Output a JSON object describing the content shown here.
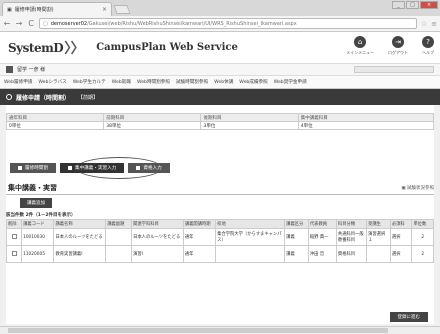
{
  "browser": {
    "tab_title": "履修申請(時間割)",
    "tab_close": "×",
    "back": "←",
    "forward": "→",
    "reload": "C",
    "url_domain": "demoserver02",
    "url_path": "/Gakusei/web/Rishu/WebRishuShinsei/kamwari/UI/WRS_RishuShinsei_Ikamwari.aspx",
    "win_min": "_",
    "win_max": "□",
    "win_close": "×"
  },
  "header": {
    "logo_text": "SystemD",
    "logo_chevrons": "〉〉",
    "service_name": "CampusPlan Web Service",
    "icons": [
      {
        "label": "メインメニュー",
        "glyph": "⌂"
      },
      {
        "label": "ログアウト",
        "glyph": "⇥"
      },
      {
        "label": "ヘルプ",
        "glyph": "?"
      }
    ]
  },
  "user": {
    "name": "留学 一彦 様"
  },
  "menu": {
    "items": [
      "Web履修申請",
      "Webシラバス",
      "Web学生カルテ",
      "Web就職",
      "Web時間割参照",
      "試験時間割参照",
      "Web休講",
      "Web成績参照",
      "Web奨学金申請"
    ]
  },
  "page": {
    "title": "履修申請（時間割）",
    "subtitle": "【前期】"
  },
  "credits": {
    "headers": [
      "通年科目",
      "前期科目",
      "後期科目",
      "集中講義科目"
    ],
    "values": [
      "0単位",
      "38単位",
      "3単位",
      "4単位"
    ]
  },
  "subtabs": [
    {
      "label": "履修時間割"
    },
    {
      "label": "集中講義・実習入力"
    },
    {
      "label": "資格入力"
    }
  ],
  "section": {
    "title": "集中講義・実習",
    "help": "試験状況参照",
    "add_button": "講義追加",
    "count_text": "該当件数 2件（1－2件目を表示）"
  },
  "grid": {
    "columns": [
      "削除",
      "講義コード",
      "講義名称",
      "講義副題",
      "関連学科科目",
      "講義開講時期",
      "校地",
      "講義区分",
      "代表教員",
      "科目分類",
      "受講生",
      "必須科",
      "単位数"
    ],
    "rows": [
      [
        "",
        "10010030",
        "日本人のルーツをたどる",
        "",
        "日本人のルーツをたどる",
        "通年",
        "集合学院大学（からすまキャンパス）",
        "講義",
        "稲野 典一",
        "共通科目一般教養科目",
        "演習選択１",
        "選択",
        "2"
      ],
      [
        "",
        "11020005",
        "教育実習講義Ⅰ",
        "",
        "演習Ⅰ",
        "通年",
        "",
        "講義",
        "沖田 哲",
        "資格科目",
        "",
        "選択",
        "2"
      ]
    ]
  },
  "footer": {
    "confirm_button": "登録に進む"
  }
}
